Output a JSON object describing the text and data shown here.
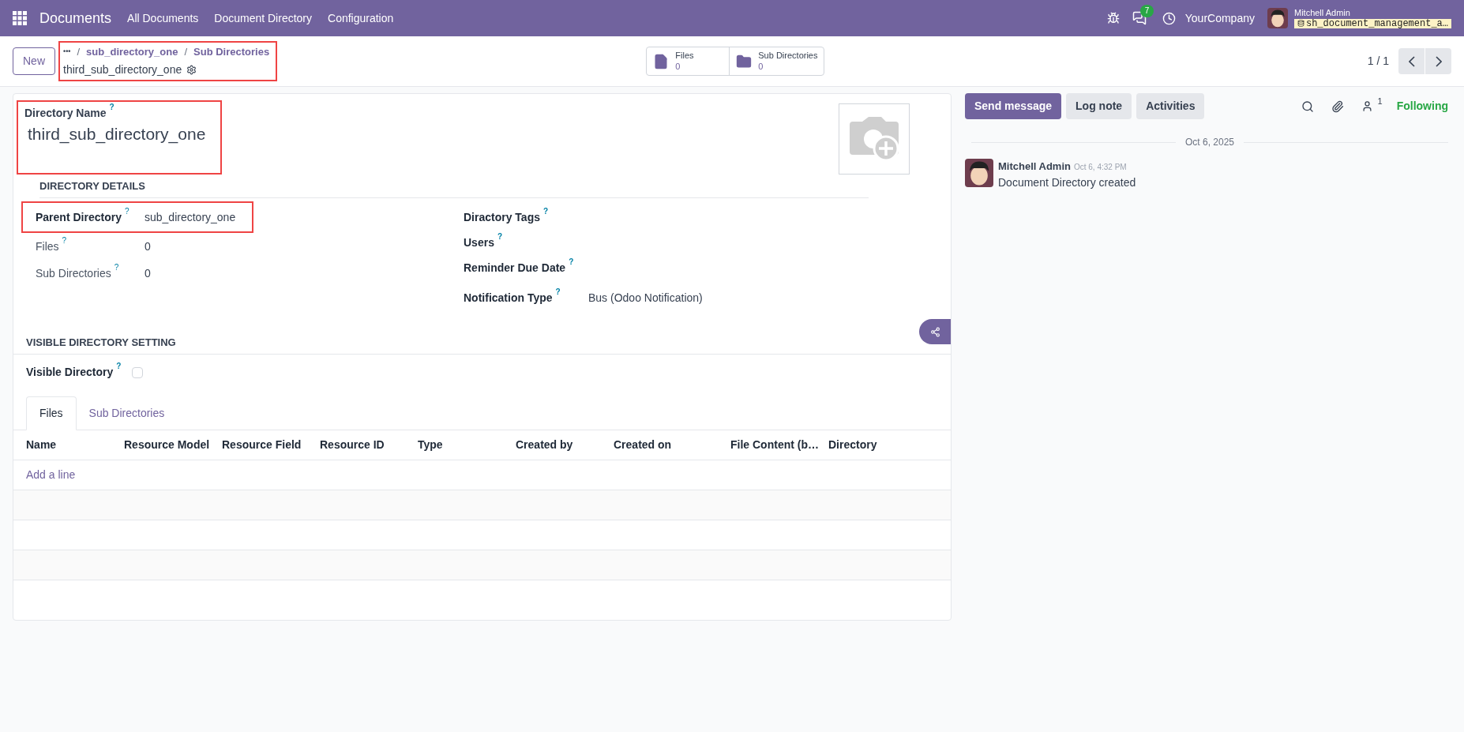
{
  "navbar": {
    "app_name": "Documents",
    "menus": [
      "All Documents",
      "Document Directory",
      "Configuration"
    ],
    "chat_badge": "7",
    "company": "YourCompany",
    "user_name": "Mitchell Admin",
    "database": "sh_document_management_a…"
  },
  "control_panel": {
    "new_button": "New",
    "breadcrumb_more": "•••",
    "breadcrumbs": [
      {
        "separator": "/",
        "label": "sub_directory_one"
      },
      {
        "separator": "/",
        "label": "Sub Directories"
      }
    ],
    "record_title": "third_sub_directory_one",
    "highlighted": true,
    "smart_buttons": [
      {
        "kind": "file",
        "label": "Files",
        "value": "0"
      },
      {
        "kind": "folder",
        "label": "Sub Directories",
        "value": "0"
      }
    ],
    "pager": "1 / 1"
  },
  "form": {
    "name_label": "Directory Name",
    "name_help": "?",
    "name_value": "third_sub_directory_one",
    "name_highlighted": true,
    "details_title": "DIRECTORY DETAILS",
    "left_fields": [
      {
        "label": "Parent Directory",
        "help": "?",
        "value": "sub_directory_one",
        "bold": true,
        "highlighted": true
      },
      {
        "label": "Files",
        "help": "?",
        "value": "0",
        "bold": false,
        "highlighted": false
      },
      {
        "label": "Sub Directories",
        "help": "?",
        "value": "0",
        "bold": false,
        "highlighted": false
      }
    ],
    "right_fields": [
      {
        "label": "Diractory Tags",
        "help": "?"
      },
      {
        "label": "Users",
        "help": "?"
      },
      {
        "label": "Reminder Due Date",
        "help": "?"
      },
      {
        "label": "Notification Type",
        "help": "?",
        "value": "Bus (Odoo Notification)"
      }
    ],
    "visible_title": "VISIBLE DIRECTORY SETTING",
    "visible_label": "Visible Directory",
    "visible_help": "?",
    "visible_checked": false,
    "tabs": [
      {
        "label": "Files",
        "selected": true
      },
      {
        "label": "Sub Directories",
        "selected": false
      }
    ],
    "table": {
      "columns": [
        "Name",
        "Resource Model",
        "Resource Field",
        "Resource ID",
        "Type",
        "Created by",
        "Created on",
        "File Content (b…",
        "Directory"
      ],
      "add_line": "Add a line"
    }
  },
  "chatter": {
    "buttons": [
      {
        "label": "Send message",
        "selected": true
      },
      {
        "label": "Log note",
        "selected": false
      },
      {
        "label": "Activities",
        "selected": false
      }
    ],
    "follower_count": "1",
    "following": "Following",
    "date": "Oct 6, 2025",
    "messages": [
      {
        "author": "Mitchell Admin",
        "time": "Oct 6, 4:32 PM",
        "body": "Document Directory created"
      }
    ]
  }
}
